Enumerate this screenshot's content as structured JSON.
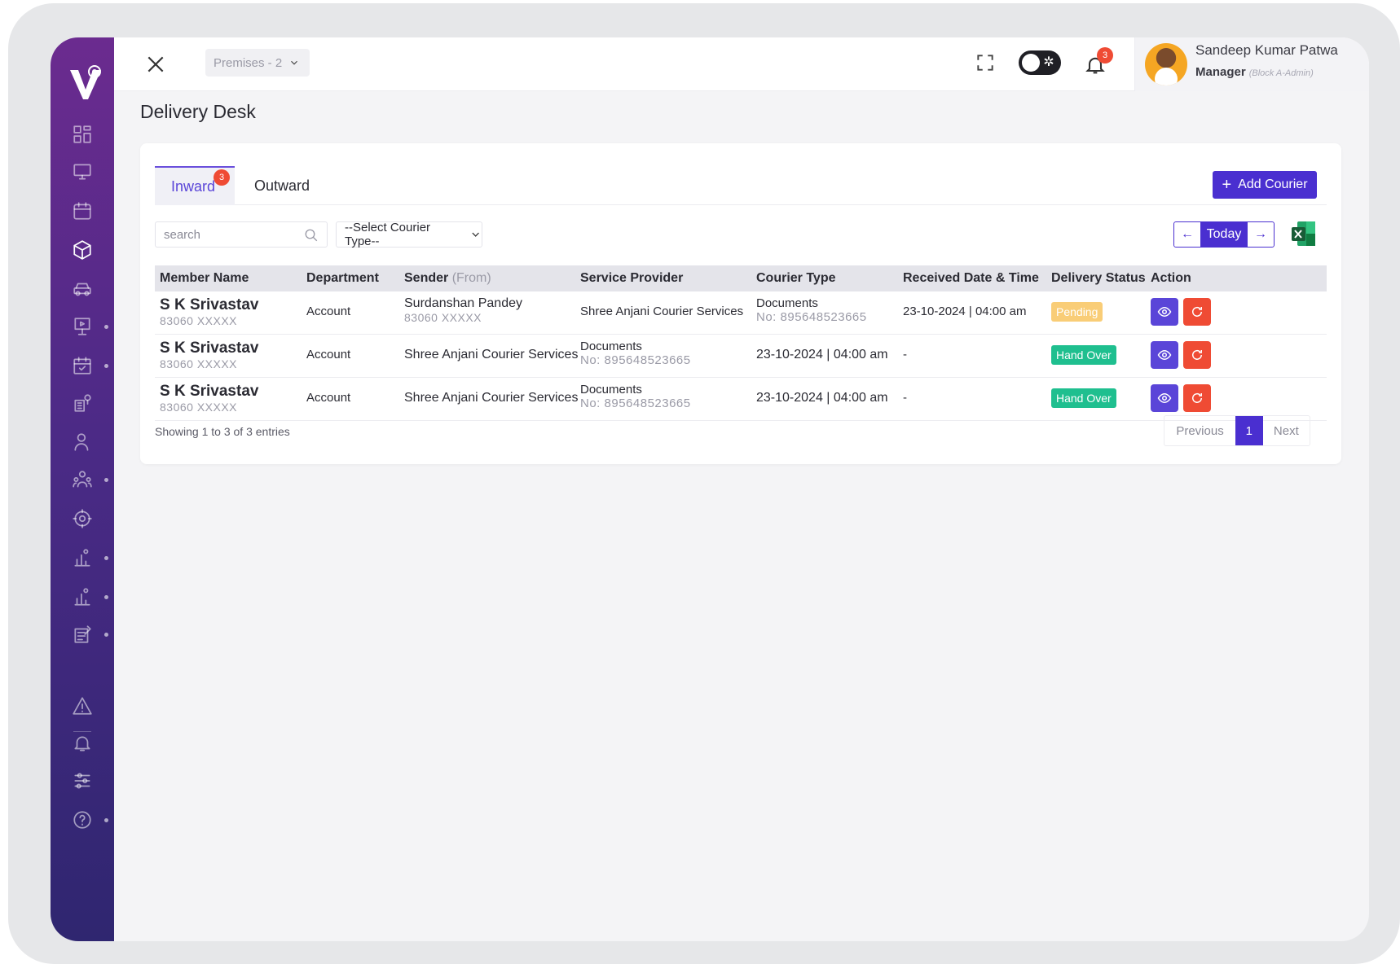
{
  "topbar": {
    "premises_label": "Premises - 2",
    "notification_count": "3",
    "user_name": "Sandeep Kumar Patwa",
    "user_role": "Manager",
    "user_role_sub": "(Block A-Admin)"
  },
  "page": {
    "title": "Delivery Desk"
  },
  "tabs": {
    "inward_label": "Inward",
    "inward_badge": "3",
    "outward_label": "Outward"
  },
  "toolbar": {
    "add_courier_label": "Add Courier",
    "search_placeholder": "search",
    "select_courier_type": "--Select Courier Type--",
    "today_label": "Today"
  },
  "table": {
    "headers": {
      "member_name": "Member Name",
      "department": "Department",
      "sender": "Sender",
      "sender_muted": "(From)",
      "service_provider": "Service Provider",
      "courier_type": "Courier Type",
      "received": "Received Date & Time",
      "delivery_status": "Delivery Status",
      "action": "Action"
    },
    "rows": [
      {
        "name": "S K Srivastav",
        "phone": "83060 XXXXX",
        "department": "Account",
        "sender": "Surdanshan Pandey",
        "sender_phone": "83060 XXXXX",
        "provider": "Shree Anjani Courier Services",
        "courier_type": "Documents",
        "courier_no": "No: 895648523665",
        "received": "23-10-2024 | 04:00 am",
        "status": "Pending"
      },
      {
        "name": "S K Srivastav",
        "phone": "83060 XXXXX",
        "department": "Account",
        "sender": "Shree Anjani Courier Services",
        "provider": "Documents",
        "provider_no": "No: 895648523665",
        "courier_type": "23-10-2024 | 04:00 am",
        "received": "-",
        "status": "Hand Over"
      },
      {
        "name": "S K Srivastav",
        "phone": "83060 XXXXX",
        "department": "Account",
        "sender": "Shree Anjani Courier Services",
        "provider": "Documents",
        "provider_no": "No: 895648523665",
        "courier_type": "23-10-2024 | 04:00 am",
        "received": "-",
        "status": "Hand Over"
      }
    ]
  },
  "footer": {
    "showing": "Showing 1 to 3 of 3 entries",
    "previous": "Previous",
    "current_page": "1",
    "next": "Next"
  },
  "colors": {
    "accent": "#4a2fd0",
    "pending": "#f9cd77",
    "handover": "#1fbf8f",
    "danger": "#ef4b34"
  },
  "icons": {
    "sidebar": [
      "dashboard-icon",
      "monitor-icon",
      "calendar-icon",
      "package-icon",
      "car-icon",
      "presentation-icon",
      "calendar-event-icon",
      "building-location-icon",
      "users-icon",
      "team-icon",
      "settings-gear-icon",
      "chart-icon",
      "chart-alt-icon",
      "report-icon",
      "warning-icon",
      "bell-icon",
      "sliders-icon",
      "help-icon"
    ]
  }
}
